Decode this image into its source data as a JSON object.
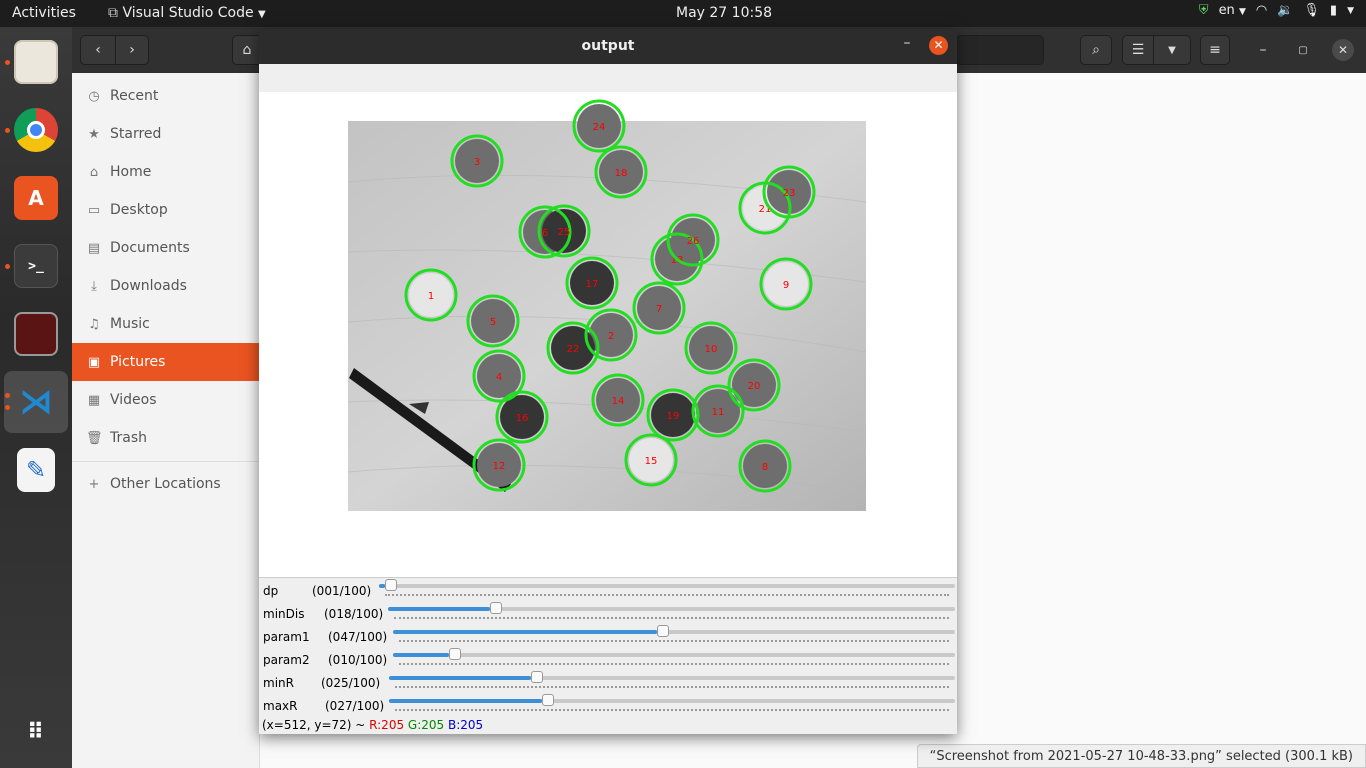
{
  "topbar": {
    "activities": "Activities",
    "app_menu": "Visual Studio Code",
    "clock": "May 27  10:58",
    "language": "en"
  },
  "dock": {
    "items": [
      "files",
      "chrome",
      "software",
      "terminal",
      "editor-app",
      "vscode",
      "text-editor",
      "show-apps"
    ]
  },
  "nautilus": {
    "sidebar": {
      "items": [
        {
          "label": "Recent",
          "icon": "clock-icon"
        },
        {
          "label": "Starred",
          "icon": "star-icon"
        },
        {
          "label": "Home",
          "icon": "home-icon"
        },
        {
          "label": "Desktop",
          "icon": "desktop-icon"
        },
        {
          "label": "Documents",
          "icon": "document-icon"
        },
        {
          "label": "Downloads",
          "icon": "download-icon"
        },
        {
          "label": "Music",
          "icon": "music-icon"
        },
        {
          "label": "Pictures",
          "icon": "picture-icon"
        },
        {
          "label": "Videos",
          "icon": "video-icon"
        },
        {
          "label": "Trash",
          "icon": "trash-icon"
        }
      ],
      "other": "Other Locations"
    },
    "status": "“Screenshot from 2021-05-27 10-48-33.png” selected  (300.1 kB)"
  },
  "cv_window": {
    "title": "output",
    "trackbars": [
      {
        "name": "dp",
        "value": "(001/100)",
        "fraction": 0.01
      },
      {
        "name": "minDis",
        "value": "(018/100)",
        "fraction": 0.18
      },
      {
        "name": "param1",
        "value": "(047/100)",
        "fraction": 0.47
      },
      {
        "name": "param2",
        "value": "(010/100)",
        "fraction": 0.1
      },
      {
        "name": "minR",
        "value": "(025/100)",
        "fraction": 0.25
      },
      {
        "name": "maxR",
        "value": "(027/100)",
        "fraction": 0.27
      }
    ],
    "status": {
      "coords": "(x=512, y=72) ~ ",
      "r": "R:205",
      "g": "G:205",
      "b": "B:205"
    },
    "circles": [
      {
        "label": "1",
        "shade": "light"
      },
      {
        "label": "2",
        "shade": "mid"
      },
      {
        "label": "3",
        "shade": "mid"
      },
      {
        "label": "4",
        "shade": "mid"
      },
      {
        "label": "5",
        "shade": "mid"
      },
      {
        "label": "6",
        "shade": "mid"
      },
      {
        "label": "7",
        "shade": "mid"
      },
      {
        "label": "8",
        "shade": "mid"
      },
      {
        "label": "9",
        "shade": "light"
      },
      {
        "label": "10",
        "shade": "mid"
      },
      {
        "label": "11",
        "shade": "mid"
      },
      {
        "label": "12",
        "shade": "mid"
      },
      {
        "label": "13",
        "shade": "mid"
      },
      {
        "label": "14",
        "shade": "mid"
      },
      {
        "label": "15",
        "shade": "light"
      },
      {
        "label": "16",
        "shade": "dark"
      },
      {
        "label": "17",
        "shade": "dark"
      },
      {
        "label": "18",
        "shade": "mid"
      },
      {
        "label": "19",
        "shade": "dark"
      },
      {
        "label": "20",
        "shade": "mid"
      },
      {
        "label": "21",
        "shade": "light"
      },
      {
        "label": "22",
        "shade": "dark"
      },
      {
        "label": "23",
        "shade": "mid"
      },
      {
        "label": "24",
        "shade": "mid"
      },
      {
        "label": "25",
        "shade": "dark"
      },
      {
        "label": "26",
        "shade": "mid"
      }
    ],
    "colors": {
      "circle": "#22dd22",
      "label": "#ff0000"
    }
  }
}
